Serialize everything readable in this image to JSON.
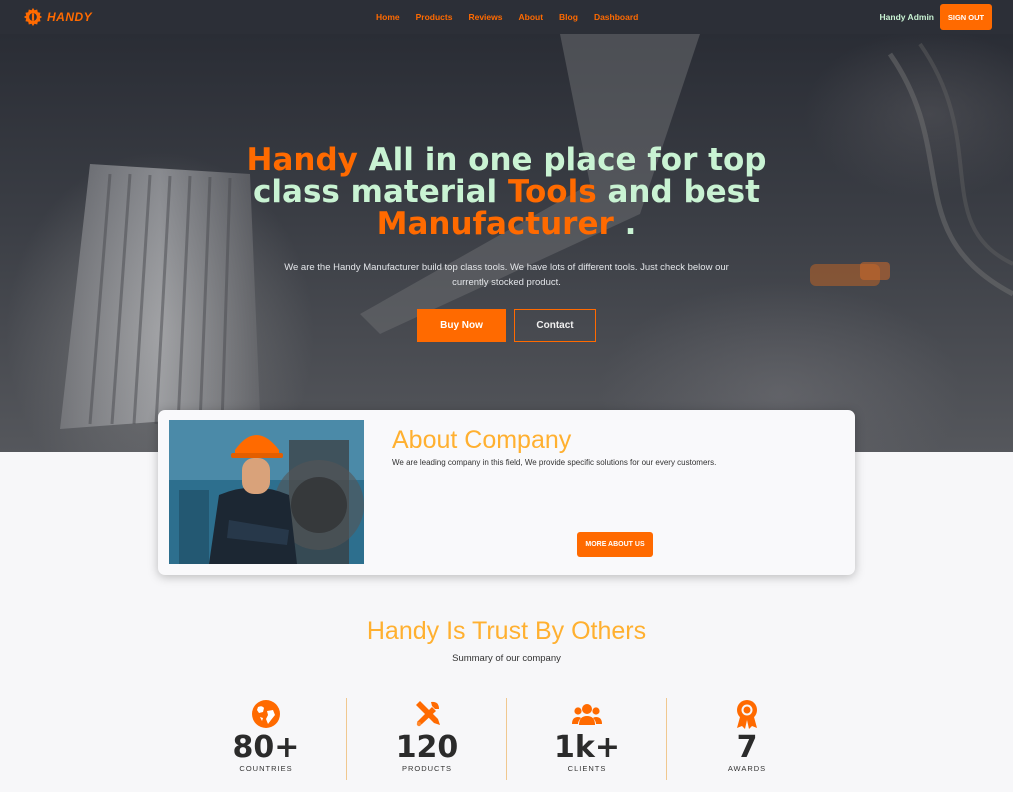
{
  "brand": {
    "name": "HANDY",
    "accent": "#ff6a00",
    "mint": "#c9f3d3",
    "gold": "#ffb030"
  },
  "nav": {
    "links": [
      "Home",
      "Products",
      "Reviews",
      "About",
      "Blog",
      "Dashboard"
    ],
    "user": "Handy Admin",
    "signout_label": "SIGN OUT"
  },
  "hero": {
    "title_parts": {
      "p1": "Handy",
      "p2": " All in one place for top",
      "p3": "class material ",
      "p4": "Tools",
      "p5": " and best",
      "p6": "Manufacturer",
      "p7": " ."
    },
    "subtitle": "We are the Handy Manufacturer build top class tools. We have lots of different tools. Just check below our currently stocked product.",
    "buy_label": "Buy Now",
    "contact_label": "Contact"
  },
  "about": {
    "title": "About Company",
    "description": "We are leading company in this field, We provide specific solutions for our every customers.",
    "button_label": "MORE ABOUT US"
  },
  "trust": {
    "title": "Handy Is Trust By Others",
    "subtitle": "Summary of our company",
    "stats": [
      {
        "value": "80+",
        "label": "COUNTRIES",
        "icon": "globe-icon"
      },
      {
        "value": "120",
        "label": "PRODUCTS",
        "icon": "tools-icon"
      },
      {
        "value": "1k+",
        "label": "CLIENTS",
        "icon": "users-icon"
      },
      {
        "value": "7",
        "label": "AWARDS",
        "icon": "award-icon"
      }
    ]
  }
}
